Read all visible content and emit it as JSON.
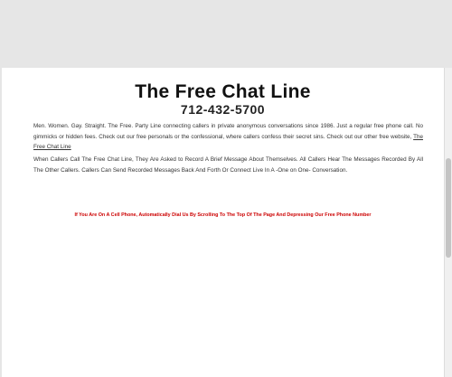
{
  "header": {
    "title": "The Free Chat Line",
    "phone": "712-432-5700"
  },
  "content": {
    "paragraph1_text": "Men. Women. Gay. Straight. The Free. Party Line connecting callers in private anonymous conversations since 1986. Just a regular free phone call. No gimmicks or hidden fees. Check out our free personals or the confessional, where callers confess their secret sins. Check out our other free website,",
    "paragraph1_link": "The Free Chat Line",
    "paragraph2_text": "When Callers Call The Free Chat Line, They Are Asked to Record A Brief Message About Themselves. All Callers Hear The Messages Recorded By All The Other Callers. Callers Can Send Recorded Messages Back And Forth Or Connect Live In A -One on One- Conversation.",
    "notice": "If You Are On A Cell Phone, Automatically Dial Us By Scrolling To The Top Of The Page And Depressing Our Free Phone Number"
  },
  "colors": {
    "notice": "#cc0000",
    "background": "#e6e6e6",
    "page": "#ffffff"
  }
}
